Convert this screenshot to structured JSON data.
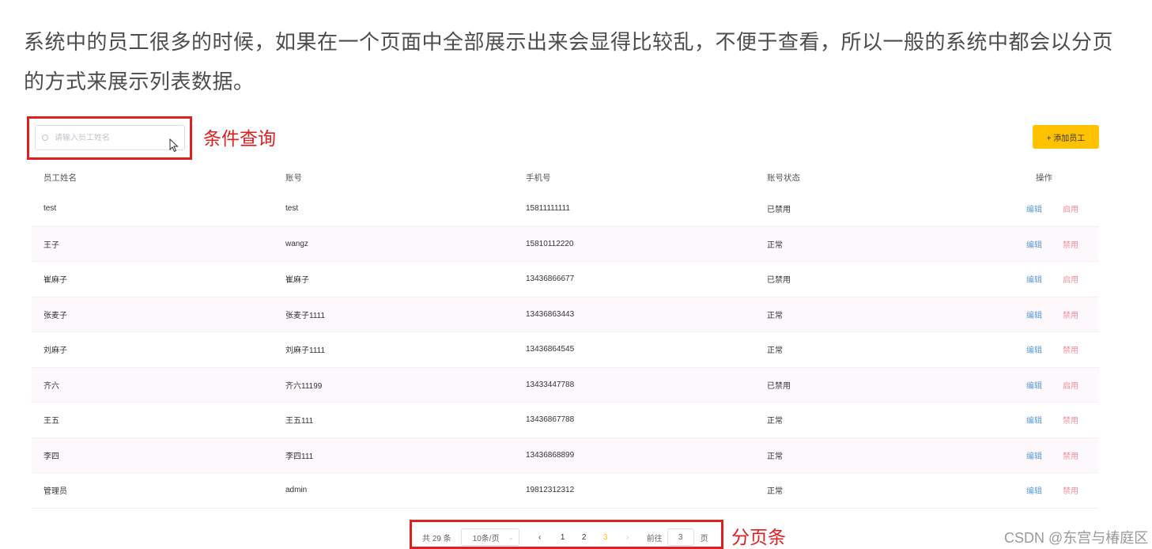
{
  "intro_text": "系统中的员工很多的时候，如果在一个页面中全部展示出来会显得比较乱，不便于查看，所以一般的系统中都会以分页的方式来展示列表数据。",
  "search": {
    "placeholder": "请输入员工姓名",
    "value": ""
  },
  "annotations": {
    "search": "条件查询",
    "pager": "分页条"
  },
  "toolbar": {
    "add_label": "+ 添加员工"
  },
  "table": {
    "headers": {
      "name": "员工姓名",
      "account": "账号",
      "phone": "手机号",
      "status": "账号状态",
      "ops": "操作"
    },
    "rows": [
      {
        "name": "test",
        "account": "test",
        "phone": "15811111111",
        "status": "已禁用",
        "edit": "编辑",
        "toggle": "启用"
      },
      {
        "name": "王子",
        "account": "wangz",
        "phone": "15810112220",
        "status": "正常",
        "edit": "编辑",
        "toggle": "禁用"
      },
      {
        "name": "崔麻子",
        "account": "崔麻子",
        "phone": "13436866677",
        "status": "已禁用",
        "edit": "编辑",
        "toggle": "启用"
      },
      {
        "name": "张麦子",
        "account": "张麦子1111",
        "phone": "13436863443",
        "status": "正常",
        "edit": "编辑",
        "toggle": "禁用"
      },
      {
        "name": "刘麻子",
        "account": "刘麻子1111",
        "phone": "13436864545",
        "status": "正常",
        "edit": "编辑",
        "toggle": "禁用"
      },
      {
        "name": "齐六",
        "account": "齐六11199",
        "phone": "13433447788",
        "status": "已禁用",
        "edit": "编辑",
        "toggle": "启用"
      },
      {
        "name": "王五",
        "account": "王五111",
        "phone": "13436867788",
        "status": "正常",
        "edit": "编辑",
        "toggle": "禁用"
      },
      {
        "name": "李四",
        "account": "李四111",
        "phone": "13436868899",
        "status": "正常",
        "edit": "编辑",
        "toggle": "禁用"
      },
      {
        "name": "管理员",
        "account": "admin",
        "phone": "19812312312",
        "status": "正常",
        "edit": "编辑",
        "toggle": "禁用"
      }
    ]
  },
  "pagination": {
    "total_label": "共 29 条",
    "page_size": "10条/页",
    "pages": [
      "1",
      "2",
      "3"
    ],
    "current_page": "3",
    "prev": "‹",
    "next": "›",
    "goto_label": "前往",
    "goto_value": "3",
    "page_suffix": "页"
  },
  "watermark": "CSDN @东宫与椿庭区",
  "colors": {
    "accent": "#ffc200",
    "annotation": "#e02020",
    "edit": "#5b9bd5",
    "toggle": "#f08d9a"
  }
}
